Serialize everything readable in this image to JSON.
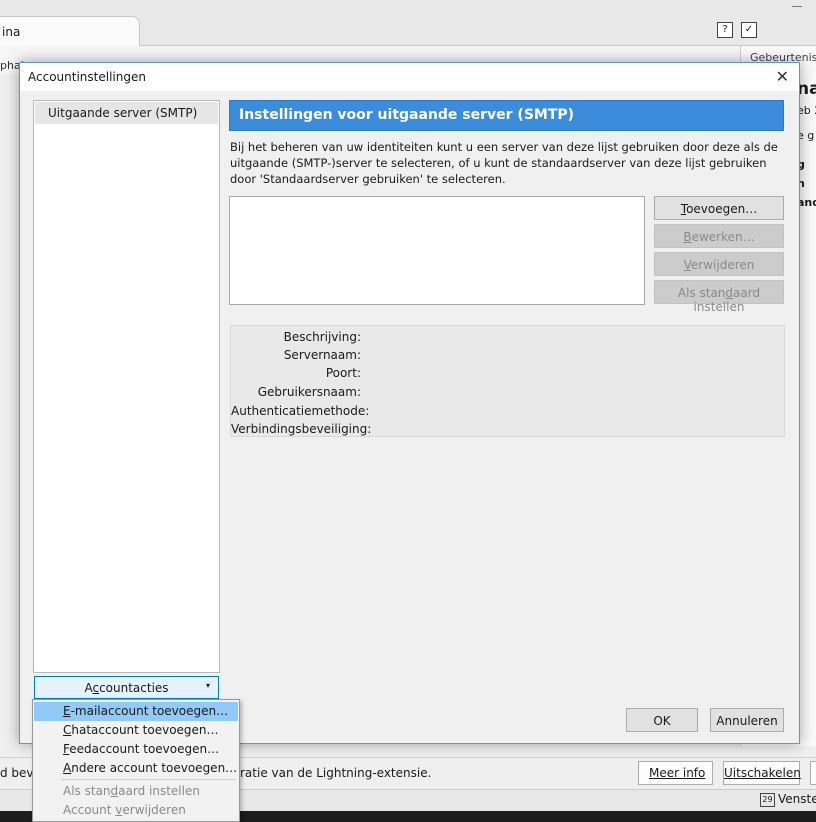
{
  "background": {
    "tab_label": "ina",
    "toolbar_text": "phal",
    "right_pane": {
      "header": "Gebeurteniss",
      "big_text": "na",
      "lines": [
        "eb 2",
        "e g",
        "g",
        "n",
        "and"
      ]
    },
    "notification": {
      "text_left": "d beva",
      "text_right": "ratie van de Lightning-extensie.",
      "more_info": "Meer info",
      "disable": "Uitschakelen"
    },
    "status": {
      "calendar_day": "29",
      "today_pane": "Venster"
    }
  },
  "dialog": {
    "title": "Accountinstellingen",
    "close_glyph": "✕",
    "sidebar": {
      "items": [
        {
          "label": "Uitgaande server (SMTP)"
        }
      ]
    },
    "account_actions": {
      "label": "Accountacties",
      "arrow": "▾"
    },
    "main": {
      "header": "Instellingen voor uitgaande server (SMTP)",
      "description": "Bij het beheren van uw identiteiten kunt u een server van deze lijst gebruiken door deze als de uitgaande (SMTP-)server te selecteren, of u kunt de standaardserver van deze lijst gebruiken door 'Standaardserver gebruiken' te selecteren.",
      "buttons": {
        "add": "Toevoegen…",
        "edit": "Bewerken…",
        "remove": "Verwijderen",
        "set_default": "Als standaard instellen"
      },
      "details": [
        {
          "label": "Beschrijving:",
          "value": ""
        },
        {
          "label": "Servernaam:",
          "value": ""
        },
        {
          "label": "Poort:",
          "value": ""
        },
        {
          "label": "Gebruikersnaam:",
          "value": ""
        },
        {
          "label": "Authenticatiemethode:",
          "value": ""
        },
        {
          "label": "Verbindingsbeveiliging:",
          "value": ""
        }
      ]
    },
    "ok": "OK",
    "cancel": "Annuleren"
  },
  "menu": {
    "items": [
      {
        "label": "E-mailaccount toevoegen…",
        "highlighted": true,
        "enabled": true
      },
      {
        "label": "Chataccount toevoegen…",
        "enabled": true
      },
      {
        "label": "Feedaccount toevoegen…",
        "enabled": true
      },
      {
        "label": "Andere account toevoegen…",
        "enabled": true
      },
      {
        "label": "Als standaard instellen",
        "enabled": false
      },
      {
        "label": "Account verwijderen",
        "enabled": false
      }
    ]
  },
  "colors": {
    "header_bg": "#3c8cdc",
    "menu_highlight": "#91c9f7",
    "dialog_border": "#5b94d9"
  }
}
